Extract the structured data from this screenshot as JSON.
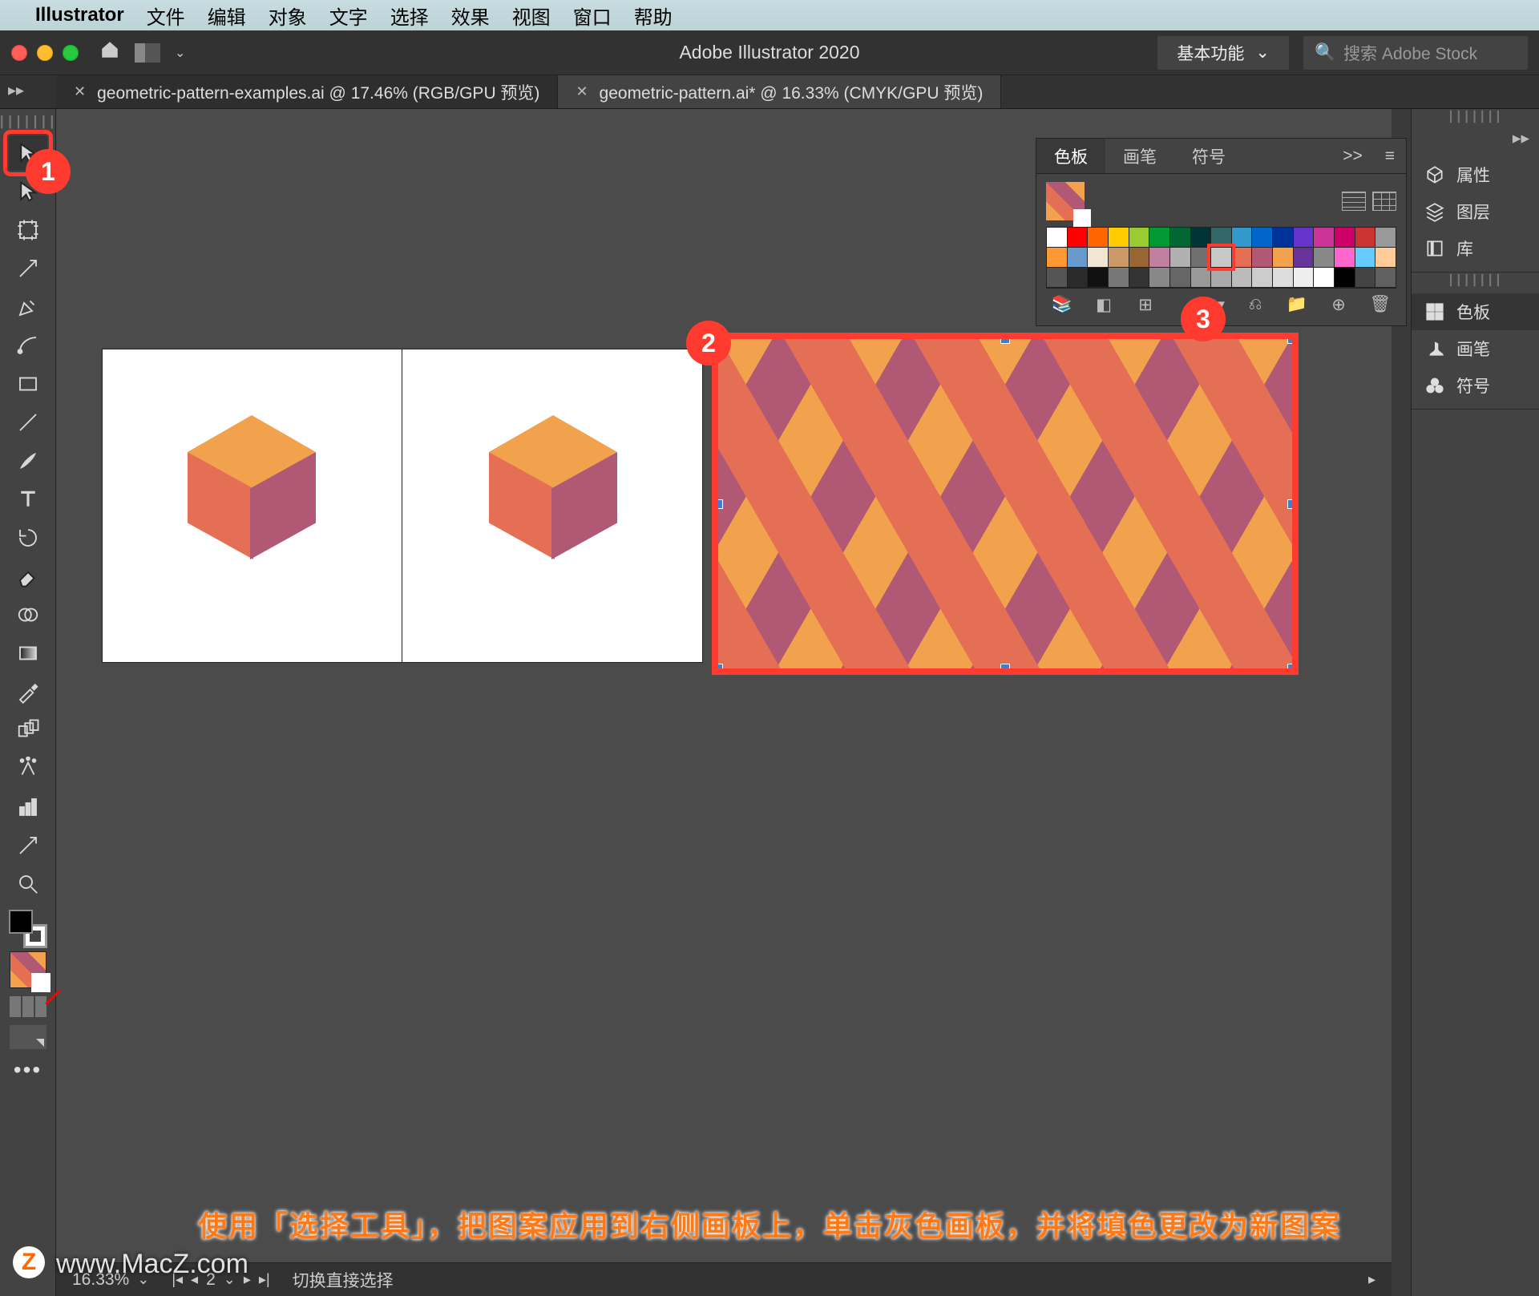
{
  "mac_menu": {
    "app": "Illustrator",
    "items": [
      "文件",
      "编辑",
      "对象",
      "文字",
      "选择",
      "效果",
      "视图",
      "窗口",
      "帮助"
    ]
  },
  "app_bar": {
    "title": "Adobe Illustrator 2020",
    "workspace": "基本功能",
    "search_placeholder": "搜索 Adobe Stock"
  },
  "tabs": [
    {
      "label": "geometric-pattern-examples.ai @ 17.46% (RGB/GPU 预览)",
      "active": false
    },
    {
      "label": "geometric-pattern.ai* @ 16.33% (CMYK/GPU 预览)",
      "active": true
    }
  ],
  "tools": [
    "selection",
    "direct-select",
    "artboard",
    "anchor",
    "pen",
    "curvature",
    "rectangle",
    "line",
    "brush",
    "type",
    "rotate",
    "eraser",
    "shape-builder",
    "gradient",
    "mesh",
    "blend",
    "eyedropper",
    "symbol-spray",
    "column-graph",
    "slice",
    "zoom"
  ],
  "swatches_panel": {
    "tabs": [
      "色板",
      "画笔",
      "符号"
    ],
    "more": ">>",
    "rows": [
      [
        "#ffffff",
        "#ff0000",
        "#ff6600",
        "#ffcc00",
        "#99cc33",
        "#009933",
        "#006633",
        "#003333",
        "#336666",
        "#3399cc",
        "#0066cc",
        "#003399",
        "#6633cc",
        "#cc3399",
        "#cc0066",
        "#cc3333",
        "#999999"
      ],
      [
        "#ff9933",
        "#6699cc",
        "#f0e6d2",
        "#cc9966",
        "#996633",
        "#c080a0",
        "#b0b0b0",
        "#707070",
        "#c8c8c8",
        "#e46f55",
        "#b05874",
        "#f2a24d",
        "#663399",
        "#888888",
        "#ff66cc",
        "#66ccff",
        "#ffcc99"
      ],
      [
        "#555555",
        "#2b2b2b",
        "#111111",
        "#777777",
        "#333333",
        "#888888",
        "#666666",
        "#999999",
        "#aaaaaa",
        "#bbbbbb",
        "#cccccc",
        "#dddddd",
        "#eeeeee",
        "#ffffff",
        "#000000",
        "#444444",
        "#606060"
      ]
    ],
    "highlight": {
      "row": 1,
      "col": 8
    }
  },
  "right_dock": {
    "group1": [
      {
        "icon": "cube",
        "label": "属性"
      },
      {
        "icon": "layers",
        "label": "图层"
      },
      {
        "icon": "book",
        "label": "库"
      }
    ],
    "group2": [
      {
        "icon": "grid",
        "label": "色板"
      },
      {
        "icon": "brush",
        "label": "画笔"
      },
      {
        "icon": "club",
        "label": "符号"
      }
    ]
  },
  "annotations": {
    "n1": "1",
    "n2": "2",
    "n3": "3"
  },
  "caption": "使用「选择工具」，把图案应用到右侧画板上，单击灰色画板，并将填色更改为新图案",
  "watermark": "www.MacZ.com",
  "watermark_badge": "Z",
  "status": {
    "zoom": "16.33%",
    "artboard_nav": "2",
    "hint": "切换直接选择"
  }
}
